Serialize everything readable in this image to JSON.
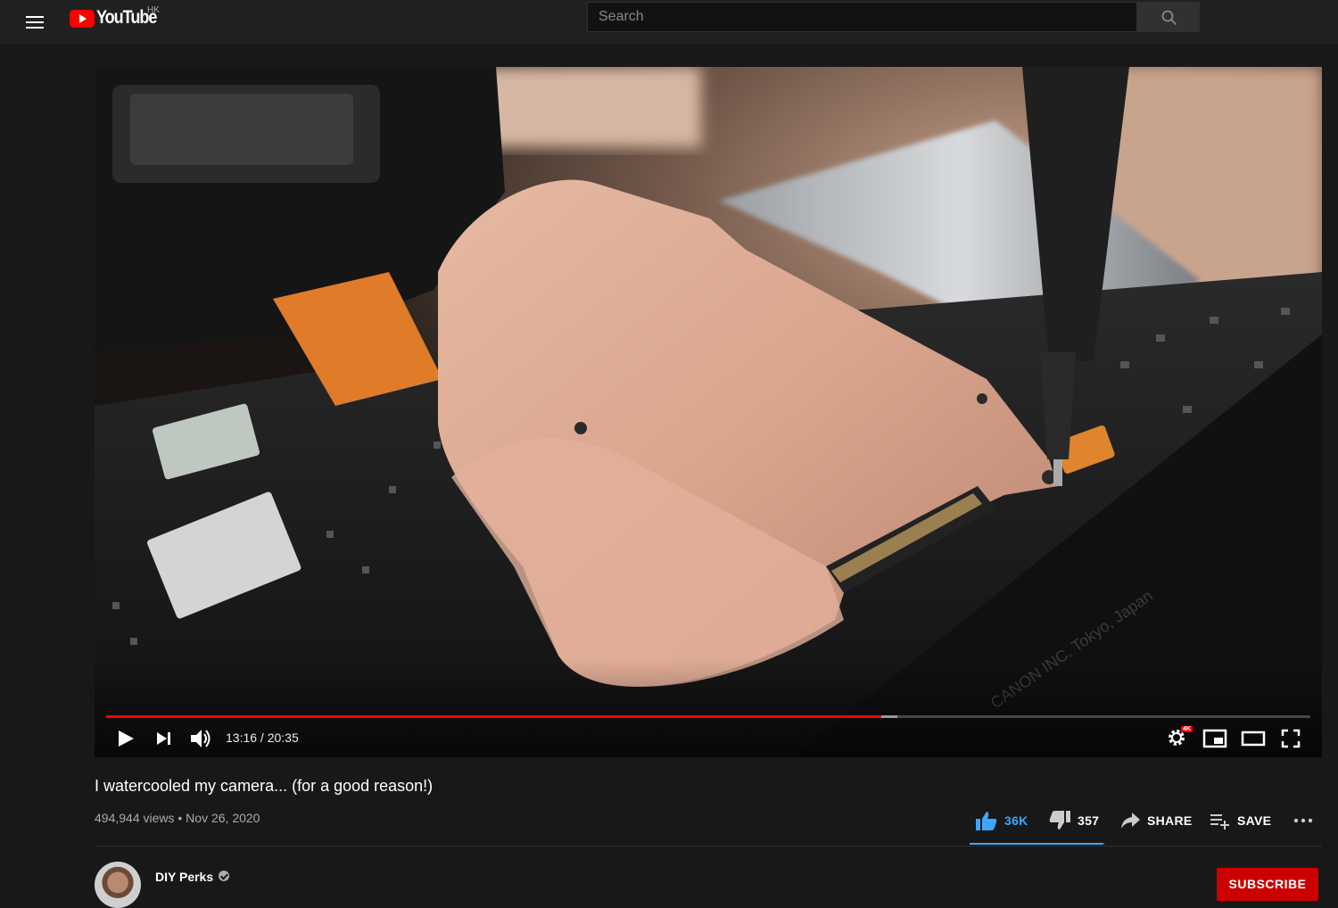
{
  "masthead": {
    "logo_text": "YouTube",
    "region": "HK",
    "search_placeholder": "Search"
  },
  "player": {
    "current_time": "13:16",
    "duration": "20:35",
    "time_display": "13:16 / 20:35",
    "played_fraction": 0.644,
    "buffered_fraction": 0.657,
    "quality_badge": "4K"
  },
  "video": {
    "title": "I watercooled my camera... (for a good reason!)",
    "views": "494,944 views",
    "date": "Nov 26, 2020",
    "meta": "494,944 views • Nov 26, 2020"
  },
  "actions": {
    "likes": "36K",
    "dislikes": "357",
    "share_label": "SHARE",
    "save_label": "SAVE",
    "like_ratio": 0.99
  },
  "channel": {
    "name": "DIY Perks",
    "subscribe_label": "SUBSCRIBE"
  },
  "colors": {
    "accent_red": "#ff0000",
    "like_blue": "#3ea6ff",
    "background": "#181818"
  }
}
